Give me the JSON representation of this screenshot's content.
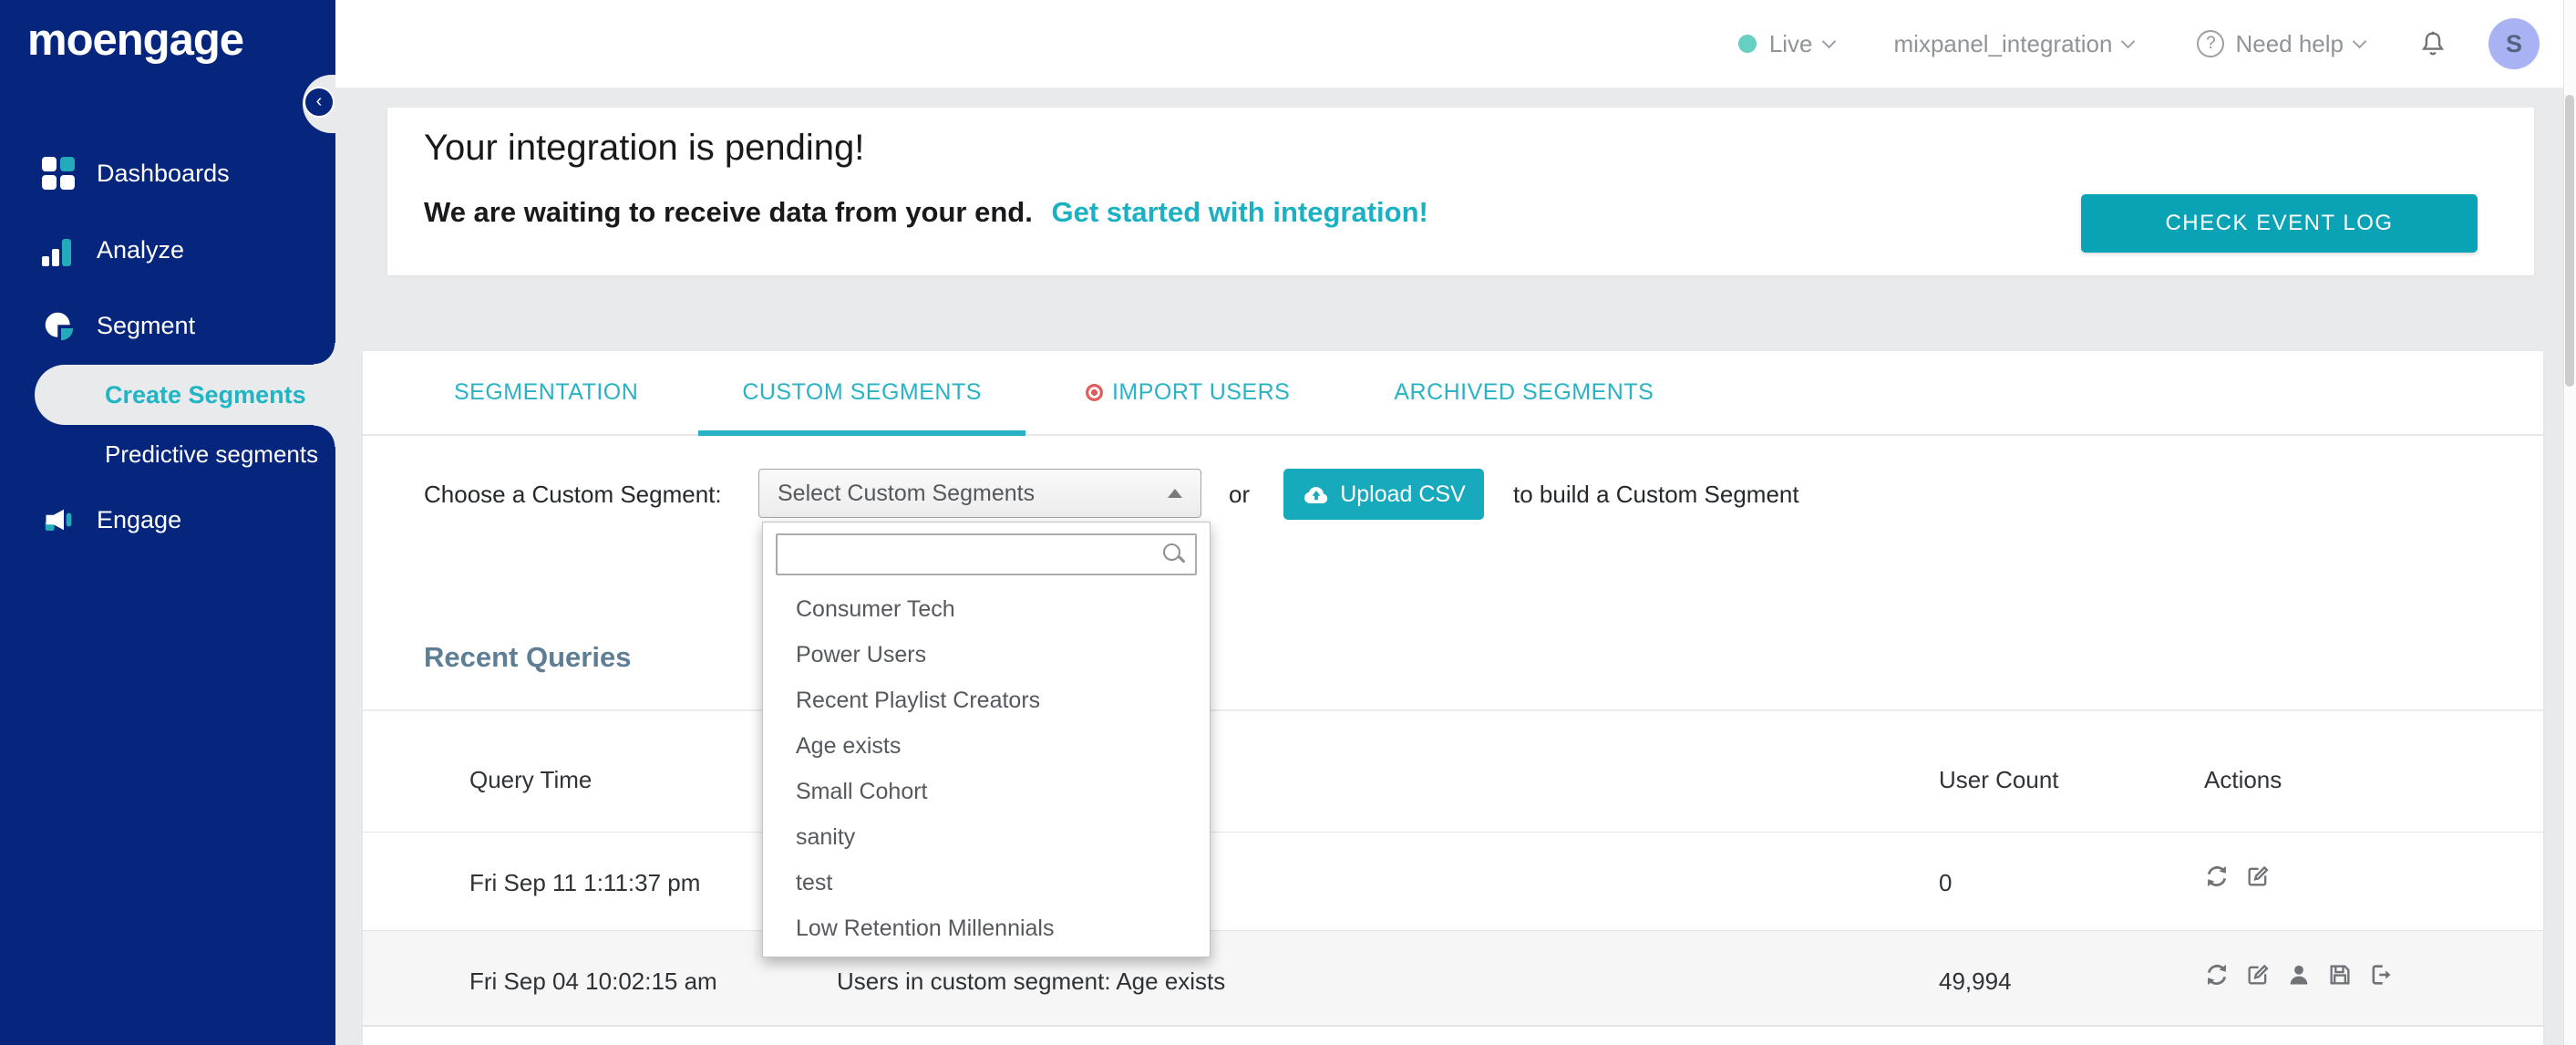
{
  "colors": {
    "navy": "#06267D",
    "teal_button": "#17A9BC",
    "teal_dark_button": "#0AA3B6",
    "tab_teal": "#2AB2C5",
    "link_teal": "#1CB0C3",
    "active_item_teal": "#1FB5C5",
    "import_dot_red": "#E15D5D",
    "heading_slate": "#5E7E95",
    "avatar_bg": "#A9B3F3",
    "live_dot": "#66D1C2"
  },
  "brand": {
    "logo": "moengage"
  },
  "topbar": {
    "live_label": "Live",
    "workspace": "mixpanel_integration",
    "help_label": "Need help",
    "question_mark": "?",
    "avatar_initial": "S"
  },
  "sidebar": {
    "items": [
      {
        "label": "Dashboards",
        "icon": "dashboard-grid-icon"
      },
      {
        "label": "Analyze",
        "icon": "bar-chart-icon"
      },
      {
        "label": "Segment",
        "icon": "pie-chart-icon"
      },
      {
        "label": "Engage",
        "icon": "megaphone-icon"
      }
    ],
    "sub_items": [
      {
        "label": "Create Segments",
        "active": true
      },
      {
        "label": "Predictive segments",
        "active": false
      }
    ]
  },
  "banner": {
    "title": "Your integration is pending!",
    "subtitle": "We are waiting to receive data from your end.",
    "link": "Get started with integration!",
    "button": "CHECK EVENT LOG"
  },
  "tabs": [
    {
      "label": "SEGMENTATION",
      "active": false
    },
    {
      "label": "CUSTOM SEGMENTS",
      "active": true
    },
    {
      "label": "IMPORT USERS",
      "active": false,
      "badge": "record-dot"
    },
    {
      "label": "ARCHIVED SEGMENTS",
      "active": false
    }
  ],
  "picker": {
    "label": "Choose a Custom Segment:",
    "select_value": "Select Custom Segments",
    "or_text": "or",
    "upload_button": "Upload CSV",
    "suffix_text": "to build a Custom Segment",
    "search_value": "",
    "search_placeholder": ""
  },
  "dropdown": {
    "items": [
      "Consumer Tech",
      "Power Users",
      "Recent Playlist Creators",
      "Age exists",
      "Small Cohort",
      "sanity",
      "test",
      "Low Retention Millennials"
    ]
  },
  "recent_queries": {
    "title": "Recent Queries",
    "columns": [
      "Query Time",
      "User Count",
      "Actions"
    ],
    "rows": [
      {
        "query_time": "Fri Sep 11 1:11:37 pm",
        "query": "",
        "user_count": "0",
        "actions": [
          "refresh",
          "edit"
        ]
      },
      {
        "query_time": "Fri Sep 04 10:02:15 am",
        "query": "Users in custom segment: Age exists",
        "user_count": "49,994",
        "actions": [
          "refresh",
          "edit",
          "user",
          "save",
          "export"
        ]
      }
    ]
  }
}
